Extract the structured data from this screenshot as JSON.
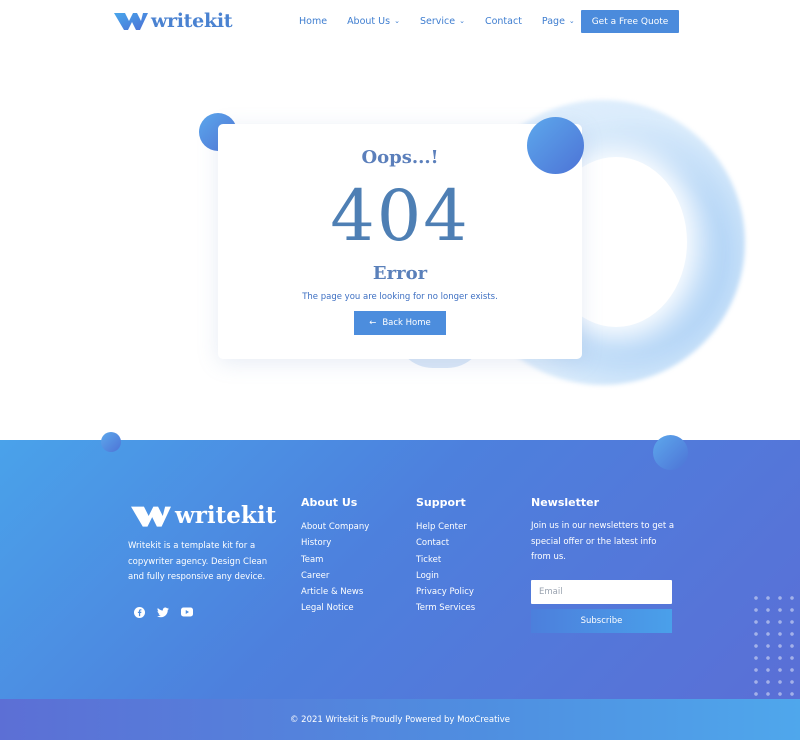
{
  "header": {
    "logo_text": "writekit",
    "nav": [
      {
        "label": "Home",
        "has_dropdown": false
      },
      {
        "label": "About Us",
        "has_dropdown": true
      },
      {
        "label": "Service",
        "has_dropdown": true
      },
      {
        "label": "Contact",
        "has_dropdown": false
      },
      {
        "label": "Page",
        "has_dropdown": true
      }
    ],
    "cta_label": "Get a Free Quote"
  },
  "error_card": {
    "oops": "Oops...!",
    "code": "404",
    "title": "Error",
    "message": "The page you are looking for no longer exists.",
    "back_label": "Back Home",
    "back_icon": "arrow-left-icon"
  },
  "footer": {
    "logo_text": "writekit",
    "description": "Writekit is a template kit for a copywriter agency. Design Clean and fully responsive any device.",
    "social": [
      "facebook-icon",
      "twitter-icon",
      "youtube-icon"
    ],
    "about": {
      "title": "About Us",
      "links": [
        "About Company",
        "History",
        "Team",
        "Career",
        "Article & News",
        "Legal Notice"
      ]
    },
    "support": {
      "title": "Support",
      "links": [
        "Help Center",
        "Contact",
        "Ticket",
        "Login",
        "Privacy Policy",
        "Term Services"
      ]
    },
    "newsletter": {
      "title": "Newsletter",
      "text": "Join us in our newsletters to get a special offer or the latest info from us.",
      "email_placeholder": "Email",
      "subscribe_label": "Subscribe"
    },
    "copyright": "© 2021 Writekit is Proudly Powered by MoxCreative"
  },
  "colors": {
    "brand_blue": "#4b8bdc",
    "heading_blue": "#4e7fb4",
    "footer_gradient_start": "#4aa2ea",
    "footer_gradient_end": "#5a6fd6"
  }
}
